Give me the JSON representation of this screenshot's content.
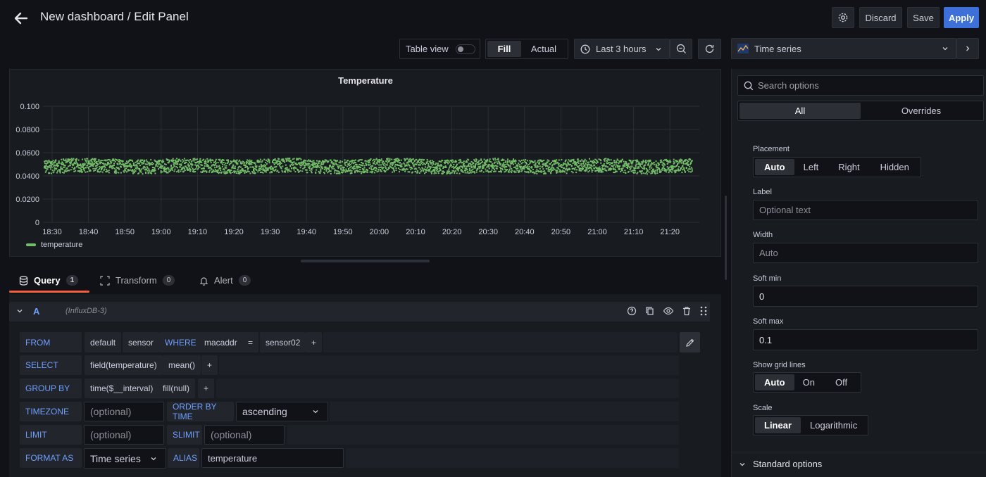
{
  "header": {
    "title": "New dashboard / Edit Panel",
    "discard_label": "Discard",
    "save_label": "Save",
    "apply_label": "Apply"
  },
  "toolbar": {
    "table_view_label": "Table view",
    "fill_label": "Fill",
    "actual_label": "Actual",
    "time_range": "Last 3 hours"
  },
  "viz_picker": {
    "label": "Time series"
  },
  "chart_data": {
    "type": "scatter",
    "title": "Temperature",
    "x_tick_labels": [
      "18:30",
      "18:40",
      "18:50",
      "19:00",
      "19:10",
      "19:20",
      "19:30",
      "19:40",
      "19:50",
      "20:00",
      "20:10",
      "20:20",
      "20:30",
      "20:40",
      "20:50",
      "21:00",
      "21:10",
      "21:20"
    ],
    "y_tick_labels": [
      "0",
      "0.0200",
      "0.0400",
      "0.0600",
      "0.0800",
      "0.100"
    ],
    "ylim": [
      0,
      0.1
    ],
    "series": [
      {
        "name": "temperature",
        "color": "#73bf69",
        "y_min": 0.043,
        "y_max": 0.055,
        "x_start": "18:30",
        "x_end": "21:28"
      }
    ],
    "legend_placement": "bottom-left",
    "grid": true
  },
  "query_tabs": [
    {
      "label": "Query",
      "count": "1"
    },
    {
      "label": "Transform",
      "count": "0"
    },
    {
      "label": "Alert",
      "count": "0"
    }
  ],
  "query": {
    "ref_id": "A",
    "datasource": "(InfluxDB-3)",
    "from": {
      "label": "FROM",
      "parts": [
        "default",
        "sensor"
      ]
    },
    "where": {
      "label": "WHERE",
      "parts": [
        "macaddr",
        "=",
        "sensor02",
        "+"
      ]
    },
    "select": {
      "label": "SELECT",
      "parts": [
        "field(temperature)",
        "mean()",
        "+"
      ]
    },
    "group_by": {
      "label": "GROUP BY",
      "parts": [
        "time($__interval)",
        "fill(null)",
        "+"
      ]
    },
    "timezone": {
      "label": "TIMEZONE",
      "placeholder": "(optional)"
    },
    "order_by": {
      "label": "ORDER BY TIME",
      "value": "ascending"
    },
    "limit": {
      "label": "LIMIT",
      "placeholder": "(optional)"
    },
    "slimit": {
      "label": "SLIMIT",
      "placeholder": "(optional)"
    },
    "format_as": {
      "label": "FORMAT AS",
      "value": "Time series"
    },
    "alias": {
      "label": "ALIAS",
      "value": "temperature"
    }
  },
  "options_pane": {
    "search_placeholder": "Search options",
    "tab_all": "All",
    "tab_overrides": "Overrides",
    "placement": {
      "label": "Placement",
      "options": [
        "Auto",
        "Left",
        "Right",
        "Hidden"
      ],
      "selected": "Auto"
    },
    "label_field": {
      "label": "Label",
      "placeholder": "Optional text"
    },
    "width_field": {
      "label": "Width",
      "placeholder": "Auto"
    },
    "soft_min": {
      "label": "Soft min",
      "value": "0"
    },
    "soft_max": {
      "label": "Soft max",
      "value": "0.1"
    },
    "grid_lines": {
      "label": "Show grid lines",
      "options": [
        "Auto",
        "On",
        "Off"
      ],
      "selected": "Auto"
    },
    "scale": {
      "label": "Scale",
      "options": [
        "Linear",
        "Logarithmic"
      ],
      "selected": "Linear"
    },
    "standard_options": "Standard options"
  }
}
